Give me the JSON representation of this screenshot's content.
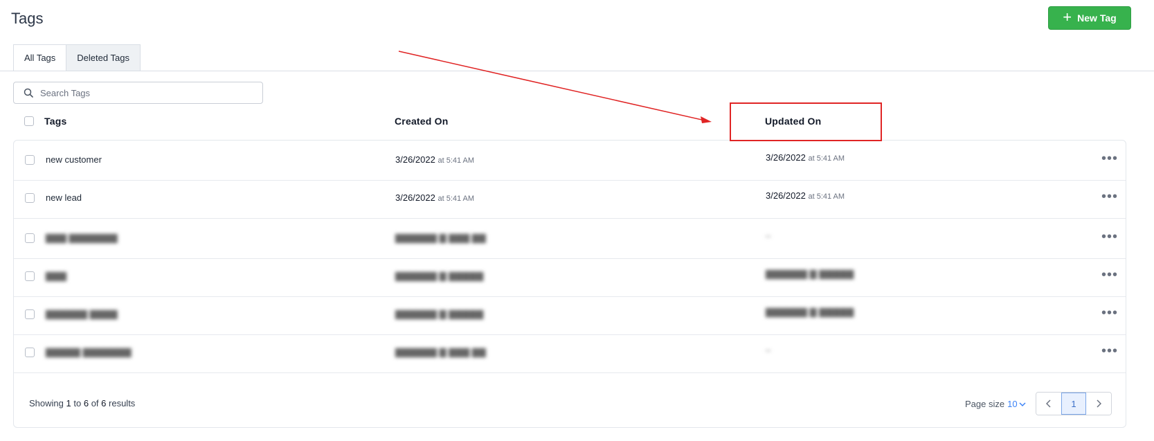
{
  "page": {
    "title": "Tags"
  },
  "toolbar": {
    "new_tag_label": "New Tag",
    "new_tag_icon": "plus-icon"
  },
  "tabs": [
    {
      "label": "All Tags",
      "active": true
    },
    {
      "label": "Deleted Tags",
      "active": false
    }
  ],
  "search": {
    "placeholder": "Search Tags",
    "value": ""
  },
  "table": {
    "headers": {
      "tags": "Tags",
      "created": "Created On",
      "updated": "Updated On"
    },
    "rows": [
      {
        "tag": "new customer",
        "created_date": "3/26/2022",
        "created_time": "at 5:41 AM",
        "updated_date": "3/26/2022",
        "updated_time": "at 5:41 AM",
        "blurred": false
      },
      {
        "tag": "new lead",
        "created_date": "3/26/2022",
        "created_time": "at 5:41 AM",
        "updated_date": "3/26/2022",
        "updated_time": "at 5:41 AM",
        "blurred": false
      },
      {
        "tag": "",
        "created_date": "",
        "created_time": "",
        "updated_date": "",
        "updated_time": "",
        "blurred": true
      },
      {
        "tag": "",
        "created_date": "",
        "created_time": "",
        "updated_date": "",
        "updated_time": "",
        "blurred": true
      },
      {
        "tag": "",
        "created_date": "",
        "created_time": "",
        "updated_date": "",
        "updated_time": "",
        "blurred": true
      },
      {
        "tag": "",
        "created_date": "",
        "created_time": "",
        "updated_date": "",
        "updated_time": "",
        "blurred": true
      }
    ]
  },
  "footer": {
    "showing_prefix": "Showing",
    "from": "1",
    "to_word": "to",
    "to": "6",
    "of_word": "of",
    "total": "6",
    "results_word": "results",
    "page_size_label": "Page size",
    "page_size_value": "10",
    "current_page": "1"
  },
  "colors": {
    "accent_green": "#37b24d",
    "annotation_red": "#e02424",
    "link_blue": "#3b82f6"
  }
}
